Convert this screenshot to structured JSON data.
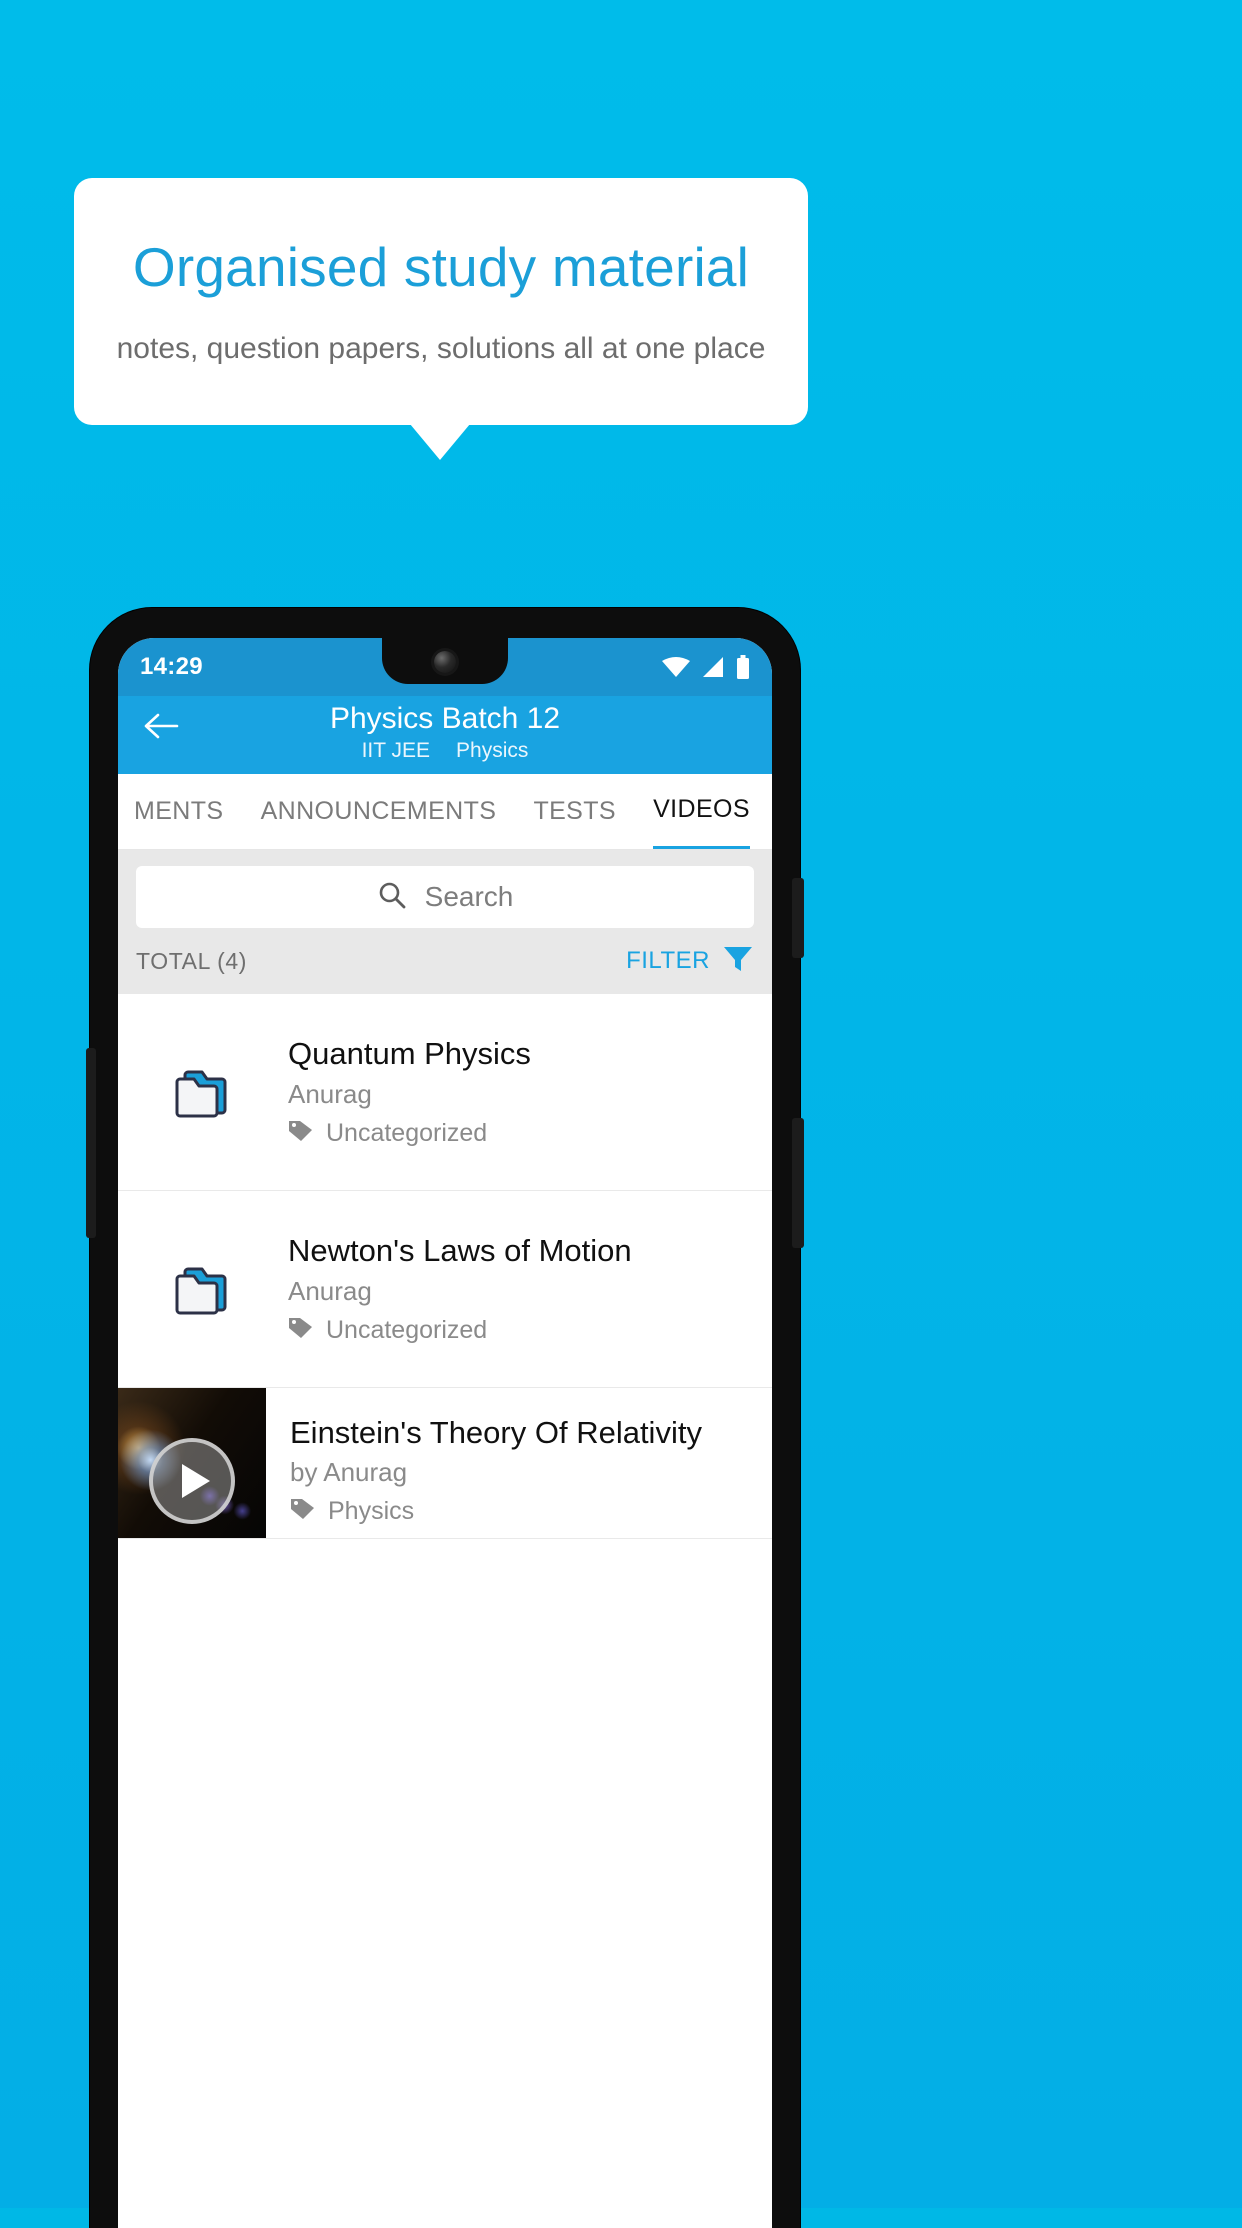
{
  "promo": {
    "title": "Organised study material",
    "subtitle": "notes, question papers, solutions all at one place",
    "title_color": "#1b9fd8",
    "background_color": "#00b8e6"
  },
  "phone": {
    "status_bar": {
      "time": "14:29",
      "icons": [
        "wifi-icon",
        "signal-icon",
        "battery-icon"
      ],
      "background_color": "#1b93cf"
    },
    "app_bar": {
      "back_icon": "back-arrow-icon",
      "title": "Physics Batch 12",
      "subtitle_items": [
        "IIT JEE",
        "Physics"
      ],
      "background_color": "#19a3e1"
    },
    "tabs": [
      {
        "label": "MENTS",
        "active": false
      },
      {
        "label": "ANNOUNCEMENTS",
        "active": false
      },
      {
        "label": "TESTS",
        "active": false
      },
      {
        "label": "VIDEOS",
        "active": true
      }
    ],
    "search": {
      "placeholder": "Search",
      "value": "",
      "icon": "search-icon"
    },
    "meta": {
      "total_label": "TOTAL (4)",
      "filter_label": "FILTER",
      "filter_icon": "filter-funnel-icon",
      "accent_color": "#19a3e1"
    },
    "list": [
      {
        "type": "folder",
        "icon": "folder-icon",
        "title": "Quantum Physics",
        "author": "Anurag",
        "tag_icon": "tag-icon",
        "tag": "Uncategorized"
      },
      {
        "type": "folder",
        "icon": "folder-icon",
        "title": "Newton's Laws of Motion",
        "author": "Anurag",
        "tag_icon": "tag-icon",
        "tag": "Uncategorized"
      },
      {
        "type": "video",
        "icon": "play-icon",
        "title": "Einstein's Theory Of Relativity",
        "author": "by Anurag",
        "tag_icon": "tag-icon",
        "tag": "Physics"
      }
    ]
  }
}
